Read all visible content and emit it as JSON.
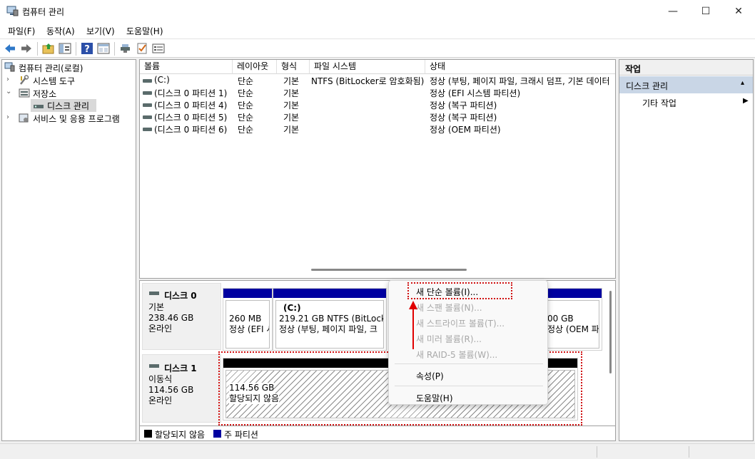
{
  "window": {
    "title": "컴퓨터 관리",
    "controls": {
      "minimize": "—",
      "maximize": "☐",
      "close": "✕"
    }
  },
  "menu": [
    "파일(F)",
    "동작(A)",
    "보기(V)",
    "도움말(H)"
  ],
  "tree": {
    "root": "컴퓨터 관리(로컬)",
    "items": [
      {
        "label": "시스템 도구"
      },
      {
        "label": "저장소"
      },
      {
        "label": "디스크 관리"
      },
      {
        "label": "서비스 및 응용 프로그램"
      }
    ]
  },
  "volume_list": {
    "columns": [
      "볼륨",
      "레이아웃",
      "형식",
      "파일 시스템",
      "상태"
    ],
    "rows": [
      [
        "(C:)",
        "단순",
        "기본",
        "NTFS (BitLocker로 암호화됨)",
        "정상 (부팅, 페이지 파일, 크래시 덤프, 기본 데이터"
      ],
      [
        "(디스크 0 파티션 1)",
        "단순",
        "기본",
        "",
        "정상 (EFI 시스템 파티션)"
      ],
      [
        "(디스크 0 파티션 4)",
        "단순",
        "기본",
        "",
        "정상 (복구 파티션)"
      ],
      [
        "(디스크 0 파티션 5)",
        "단순",
        "기본",
        "",
        "정상 (복구 파티션)"
      ],
      [
        "(디스크 0 파티션 6)",
        "단순",
        "기본",
        "",
        "정상 (OEM 파티션)"
      ]
    ]
  },
  "disks": [
    {
      "name": "디스크 0",
      "type": "기본",
      "size": "238.46 GB",
      "status": "온라인",
      "partitions": [
        {
          "line1": "260 MB",
          "line2": "정상 (EFI 시"
        },
        {
          "title": "(C:)",
          "line1": "219.21 GB NTFS (BitLocke",
          "line2": "정상 (부팅, 페이지 파일, 크"
        },
        {
          "line1": "00 GB",
          "line2": "정상 (OEM 파"
        }
      ]
    },
    {
      "name": "디스크 1",
      "type": "이동식",
      "size": "114.56 GB",
      "status": "온라인",
      "partitions": [
        {
          "line1": "114.56 GB",
          "line2": "할당되지 않음"
        }
      ]
    }
  ],
  "legend": [
    "할당되지 않음",
    "주 파티션"
  ],
  "context_menu": {
    "items": [
      {
        "label": "새 단순 볼륨(I)...",
        "enabled": true
      },
      {
        "label": "새 스팬 볼륨(N)...",
        "enabled": false
      },
      {
        "label": "새 스트라이프 볼륨(T)...",
        "enabled": false
      },
      {
        "label": "새 미러 볼륨(R)...",
        "enabled": false
      },
      {
        "label": "새 RAID-5 볼륨(W)...",
        "enabled": false
      },
      {
        "label": "속성(P)",
        "enabled": true
      },
      {
        "label": "도움말(H)",
        "enabled": true
      }
    ]
  },
  "actions": {
    "header": "작업",
    "selected": "디스크 관리",
    "more": "기타 작업"
  },
  "colors": {
    "primary_partition": "#0000a0",
    "unallocated": "#000000",
    "annotation": "#d01010",
    "selection": "#c9d6e6"
  }
}
